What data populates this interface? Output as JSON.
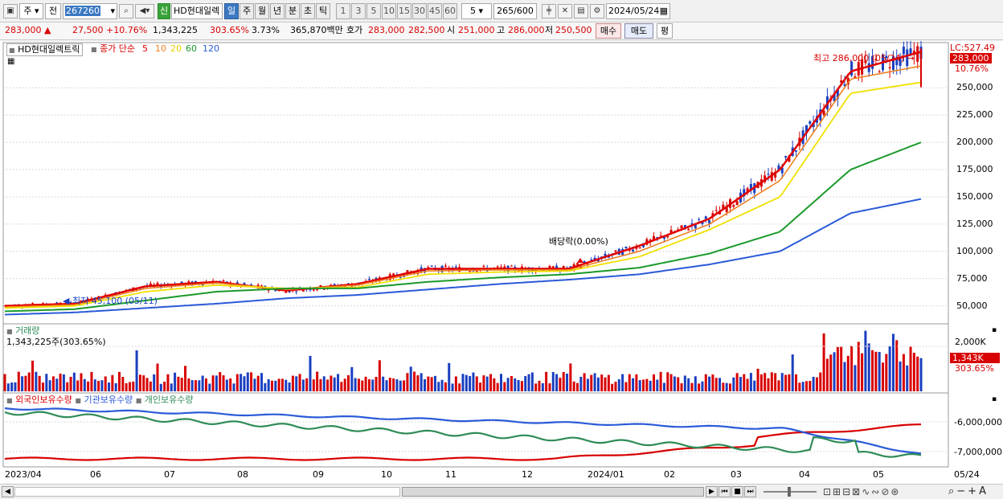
{
  "toolbar": {
    "period_type": "주",
    "prev_label": "전",
    "code": "267260",
    "stock_badge": "신",
    "stock_name": "HD현대일렉",
    "tabs": [
      "일",
      "주",
      "월",
      "년",
      "분",
      "초",
      "틱"
    ],
    "intervals": [
      "1",
      "3",
      "5",
      "10",
      "15",
      "30",
      "45",
      "60"
    ],
    "interval_select": "5",
    "count": "265",
    "count_total": "/600",
    "date": "2024/05/24"
  },
  "quote": {
    "price": "283,000",
    "change_arrow": "▲",
    "change": "27,500",
    "change_pct": "+10.76%",
    "volume": "1,343,225",
    "volume_pct": "303.65%",
    "turnover_pct": "3.73%",
    "amount": "365,870백만",
    "bid_label": "호가",
    "ask_price": "283,000",
    "bid_price": "282,500",
    "open_label": "시",
    "open": "251,000",
    "high_label": "고",
    "high": "286,000",
    "low_label": "저",
    "low": "250,500",
    "buy_label": "매수",
    "sell_label": "매도",
    "eval_label": "평"
  },
  "price_panel": {
    "legend_name": "HD현대일렉트릭",
    "legend_ma_title": "종가 단순",
    "legend_ma": [
      "5",
      "10",
      "20",
      "60",
      "120"
    ],
    "high_annotation": "최고 286,000 (05/24)",
    "low_annotation": "최저 45,100 (05/11)",
    "dividend_annotation": "배당락(0.00%)",
    "lc_label": "LC:527.49",
    "last_price_box": "283,000",
    "last_pct": "10.76%",
    "y_ticks": [
      "250,000",
      "225,000",
      "200,000",
      "175,000",
      "150,000",
      "125,000",
      "100,000",
      "75,000",
      "50,000"
    ]
  },
  "volume_panel": {
    "title": "거래량",
    "value": "1,343,225주(303.65%)",
    "y_tick": "2,000K",
    "last_box": "1,343K",
    "last_pct": "303.65%"
  },
  "holdings_panel": {
    "legend": [
      "외국인보유수량",
      "기관보유수량",
      "개인보유수량"
    ],
    "y_ticks": [
      "-6,000,000",
      "-7,000,000"
    ]
  },
  "x_axis": [
    "2023/04",
    "06",
    "07",
    "08",
    "09",
    "10",
    "11",
    "12",
    "2024/01",
    "02",
    "03",
    "04",
    "05",
    "05/24"
  ],
  "colors": {
    "ma5": "#e00000",
    "ma10": "#f08020",
    "ma20": "#f0e000",
    "ma60": "#1a9a2a",
    "ma120": "#2a5ad8",
    "up": "#d80000",
    "down": "#1a3fc0",
    "foreign": "#d80000",
    "institution": "#2a5ad8",
    "individual": "#2e8b57"
  },
  "chart_data": [
    {
      "type": "line",
      "title": "HD현대일렉트릭",
      "x": [
        "2023/04",
        "06",
        "07",
        "08",
        "09",
        "10",
        "11",
        "12",
        "2024/01",
        "02",
        "03",
        "04",
        "05",
        "05/24"
      ],
      "series": [
        {
          "name": "5",
          "values": [
            50000,
            52000,
            68000,
            72000,
            64000,
            70000,
            84000,
            84000,
            84000,
            105000,
            130000,
            175000,
            265000,
            283000
          ]
        },
        {
          "name": "10",
          "values": [
            49000,
            51000,
            66000,
            71000,
            65000,
            69000,
            82000,
            83000,
            83000,
            100000,
            125000,
            165000,
            258000,
            270000
          ]
        },
        {
          "name": "20",
          "values": [
            48000,
            50000,
            63000,
            69000,
            66000,
            67000,
            79000,
            81000,
            82000,
            95000,
            120000,
            150000,
            245000,
            255000
          ]
        },
        {
          "name": "60",
          "values": [
            45000,
            47000,
            55000,
            63000,
            66000,
            66000,
            72000,
            76000,
            79000,
            85000,
            98000,
            118000,
            175000,
            200000
          ]
        },
        {
          "name": "120",
          "values": [
            42000,
            44000,
            48000,
            52000,
            57000,
            60000,
            65000,
            70000,
            74000,
            79000,
            88000,
            100000,
            135000,
            148000
          ]
        }
      ],
      "ylim": [
        35000,
        290000
      ]
    },
    {
      "type": "bar",
      "title": "거래량",
      "ylim": [
        0,
        2600000
      ]
    },
    {
      "type": "line",
      "title": "외국인보유수량 / 기관보유수량 / 개인보유수량",
      "ylim": [
        -7500000,
        -5500000
      ]
    }
  ]
}
